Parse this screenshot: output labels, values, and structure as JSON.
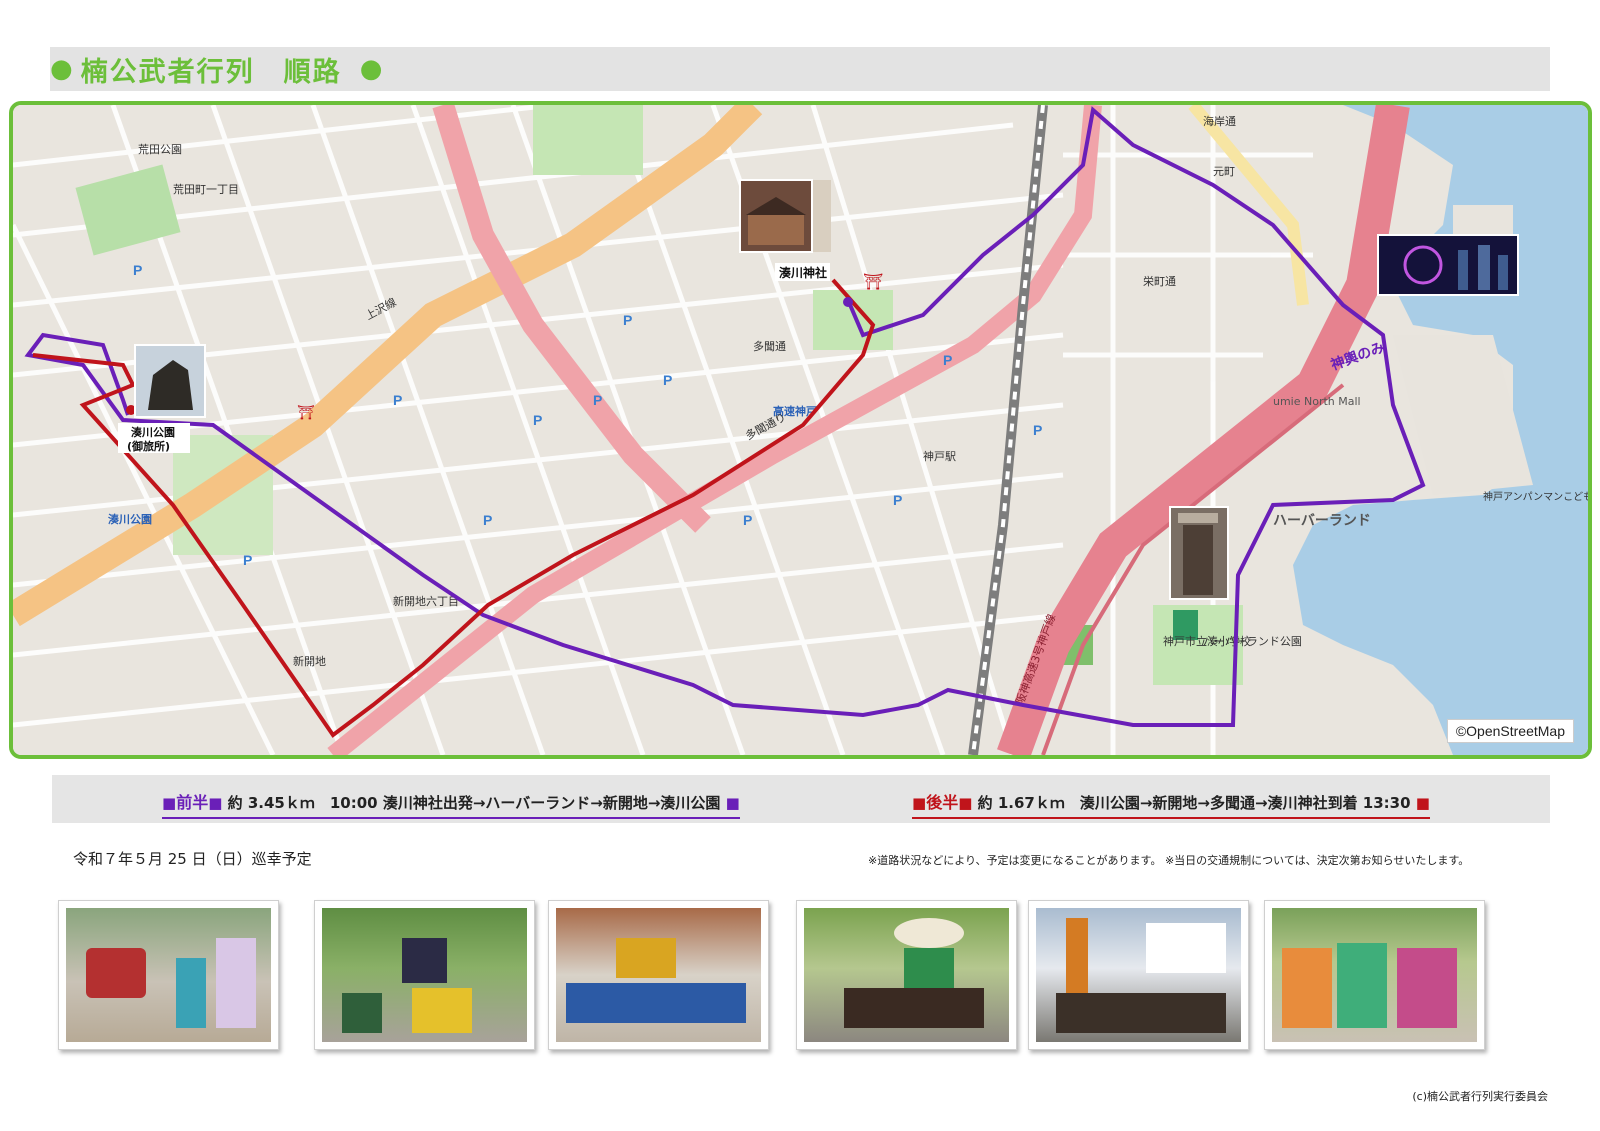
{
  "header": {
    "title": "楠公武者行列　順路",
    "dot": "●"
  },
  "map": {
    "attribution": "©OpenStreetMap",
    "landmarks": {
      "shrine": "湊川神社",
      "park_line1": "湊川公園",
      "park_line2": "(御旅所)"
    },
    "labels": {
      "arakawa_park": "荒田公園",
      "harborland": "ハーバーランド",
      "umie": "umie North Mall",
      "kobe_station": "神戸駅",
      "minatogawa_park": "湊川公園",
      "shinkaichi": "新開地",
      "kosoku_kobe": "高速神戸",
      "sakaemachi": "栄町通",
      "kamisawa": "上沢線",
      "tamon": "多聞通",
      "shinko_only": "神輿のみ",
      "tamondori": "多聞通り",
      "harborland_park": "ハーバーランド公園",
      "hanshin": "阪神高速3号神戸線",
      "kodomo": "神戸アンパンマンこどもミュージアム&モール",
      "minato_elem": "神戸市立湊小学校",
      "kaigan": "海岸通",
      "koto": "元町",
      "arata": "荒田町一丁目",
      "shinkaichi6": "新開地六丁目"
    }
  },
  "legend": {
    "first": {
      "label": "前半",
      "marker": "■",
      "text": "約 3.45ｋｍ　10:00 湊川神社出発→ハーバーランド→新開地→湊川公園"
    },
    "second": {
      "label": "後半",
      "marker": "■",
      "text": "約 1.67ｋｍ　湊川公園→新開地→多聞通→湊川神社到着 13:30"
    }
  },
  "date": "令和７年５月 25 日（日）巡幸予定",
  "note": "※道路状況などにより、予定は変更になることがあります。 ※当日の交通規制については、決定次第お知らせいたします。",
  "copyright": "(c)楠公武者行列実行委員会",
  "colors": {
    "green": "#6cbf3a",
    "purple": "#6a1fb8",
    "red": "#c0141b",
    "highway": "#e6828f",
    "primary": "#f5c384"
  },
  "icons": [
    "shrine-photo-icon",
    "statue-photo-icon",
    "ferris-wheel-photo-icon",
    "harborland-photo-icon"
  ]
}
